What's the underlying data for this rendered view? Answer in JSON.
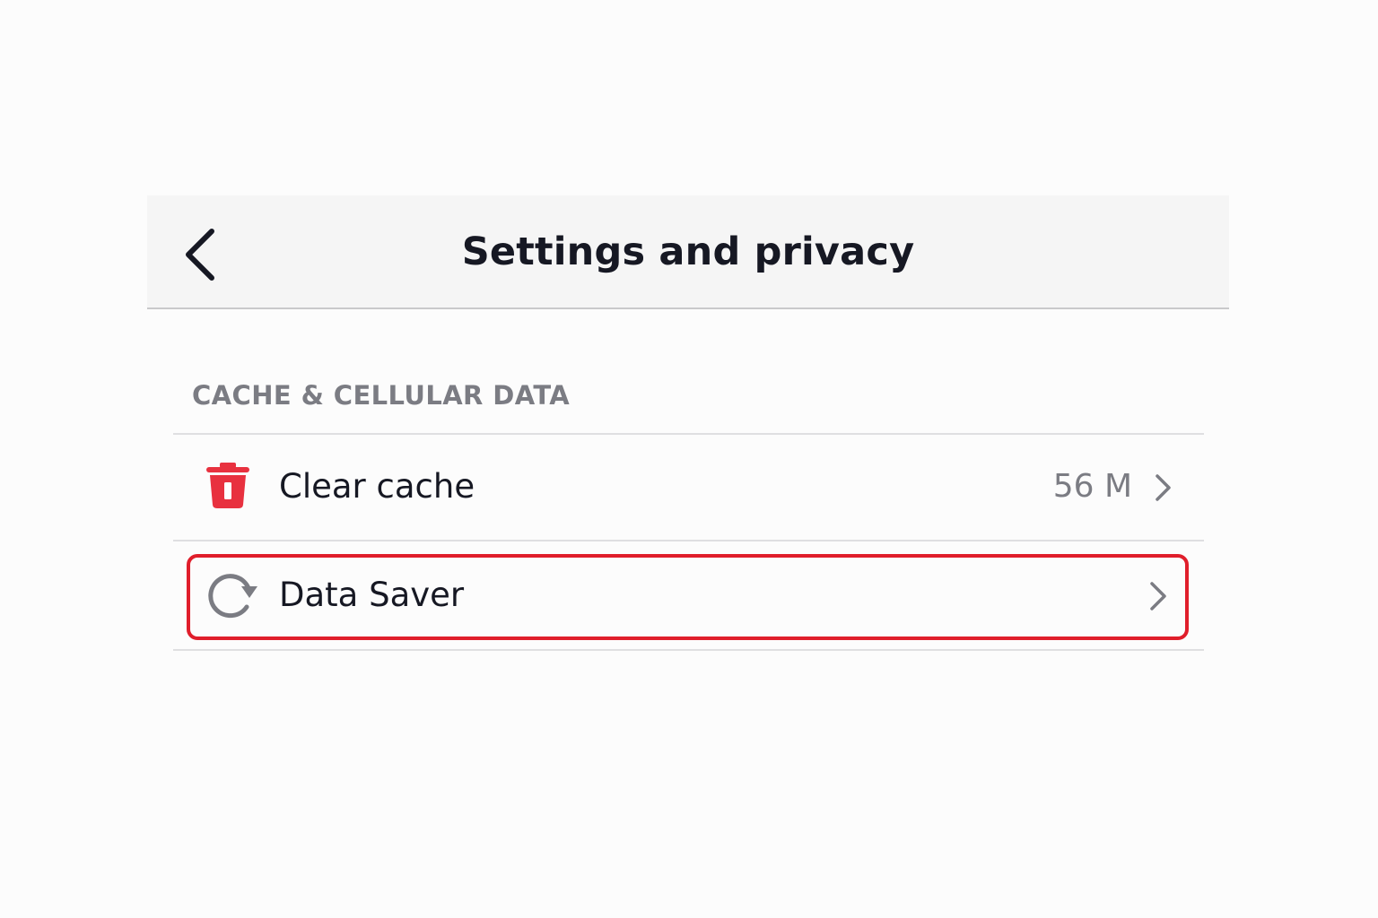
{
  "header": {
    "title": "Settings and privacy",
    "back_icon": "chevron-left-icon"
  },
  "section": {
    "title": "CACHE & CELLULAR DATA"
  },
  "rows": [
    {
      "label": "Clear cache",
      "value": "56 M",
      "icon": "trash-icon",
      "icon_color": "#e8313f",
      "trailing_icon": "chevron-right-icon"
    },
    {
      "label": "Data Saver",
      "icon": "refresh-icon",
      "icon_color": "#7b7c83",
      "trailing_icon": "chevron-right-icon",
      "highlighted": true
    }
  ],
  "colors": {
    "title_text": "#161823",
    "secondary_text": "#7b7c83",
    "highlight": "#e01e2b",
    "header_background": "#f5f5f5"
  }
}
